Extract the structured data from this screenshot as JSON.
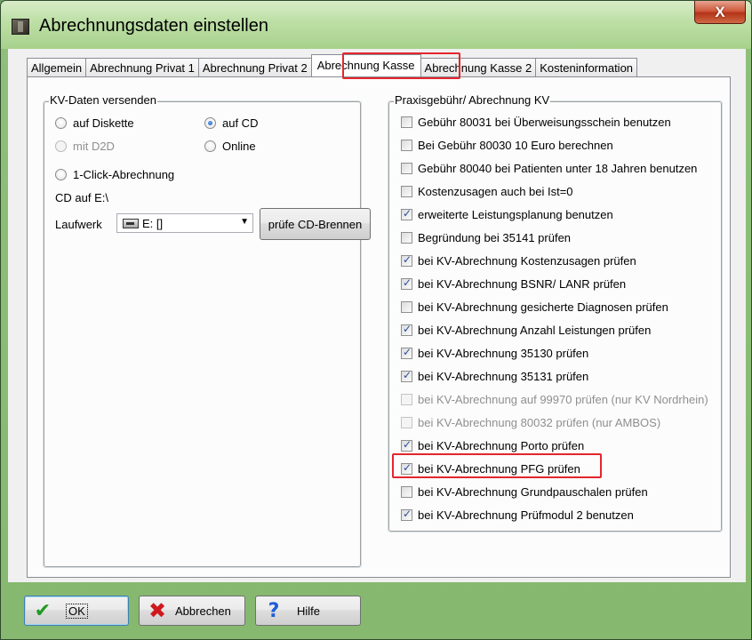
{
  "window": {
    "title": "Abrechnungsdaten einstellen",
    "close_label": "X",
    "title_icon": "app-icon"
  },
  "tabs": [
    {
      "label": "Allgemein",
      "active": false
    },
    {
      "label": "Abrechnung Privat 1",
      "active": false
    },
    {
      "label": "Abrechnung Privat 2",
      "active": false
    },
    {
      "label": "Abrechnung Kasse",
      "active": true
    },
    {
      "label": "Abrechnung Kasse 2",
      "active": false
    },
    {
      "label": "Kosteninformation",
      "active": false
    }
  ],
  "kv_group": {
    "title": "KV-Daten versenden",
    "radios": {
      "diskette": "auf Diskette",
      "cd": "auf CD",
      "d2d": "mit D2D",
      "online": "Online",
      "oneclick": "1-Click-Abrechnung"
    },
    "selected": "auf CD",
    "cd_path": "CD auf E:\\",
    "drive_label": "Laufwerk",
    "drive_value": "E: []",
    "check_burn_button": "prüfe CD-Brennen"
  },
  "praxis_group": {
    "title": "Praxisgebühr/ Abrechnung KV",
    "items": [
      {
        "label": "Gebühr 80031 bei Überweisungsschein benutzen",
        "checked": false,
        "enabled": true
      },
      {
        "label": "Bei Gebühr 80030 10 Euro berechnen",
        "checked": false,
        "enabled": true
      },
      {
        "label": "Gebühr 80040 bei Patienten unter 18 Jahren benutzen",
        "checked": false,
        "enabled": true
      },
      {
        "label": "Kostenzusagen auch bei Ist=0",
        "checked": false,
        "enabled": true
      },
      {
        "label": "erweiterte Leistungsplanung benutzen",
        "checked": true,
        "enabled": true
      },
      {
        "label": "Begründung bei 35141 prüfen",
        "checked": false,
        "enabled": true
      },
      {
        "label": "bei KV-Abrechnung Kostenzusagen prüfen",
        "checked": true,
        "enabled": true
      },
      {
        "label": "bei KV-Abrechnung BSNR/ LANR prüfen",
        "checked": true,
        "enabled": true
      },
      {
        "label": "bei KV-Abrechnung gesicherte Diagnosen prüfen",
        "checked": false,
        "enabled": true
      },
      {
        "label": "bei KV-Abrechnung Anzahl Leistungen prüfen",
        "checked": true,
        "enabled": true
      },
      {
        "label": "bei KV-Abrechnung 35130 prüfen",
        "checked": true,
        "enabled": true
      },
      {
        "label": "bei KV-Abrechnung 35131 prüfen",
        "checked": true,
        "enabled": true
      },
      {
        "label": "bei KV-Abrechnung auf 99970 prüfen (nur KV Nordrhein)",
        "checked": false,
        "enabled": false
      },
      {
        "label": "bei KV-Abrechnung 80032 prüfen (nur AMBOS)",
        "checked": false,
        "enabled": false
      },
      {
        "label": "bei KV-Abrechnung Porto prüfen",
        "checked": true,
        "enabled": true
      },
      {
        "label": "bei KV-Abrechnung PFG prüfen",
        "checked": true,
        "enabled": true
      },
      {
        "label": "bei KV-Abrechnung Grundpauschalen prüfen",
        "checked": false,
        "enabled": true
      },
      {
        "label": "bei KV-Abrechnung Prüfmodul 2 benutzen",
        "checked": true,
        "enabled": true
      }
    ]
  },
  "buttons": {
    "ok": "OK",
    "cancel": "Abbrechen",
    "help": "Hilfe"
  },
  "colors": {
    "highlight": "#e4262d",
    "frame": "#86b86f"
  }
}
